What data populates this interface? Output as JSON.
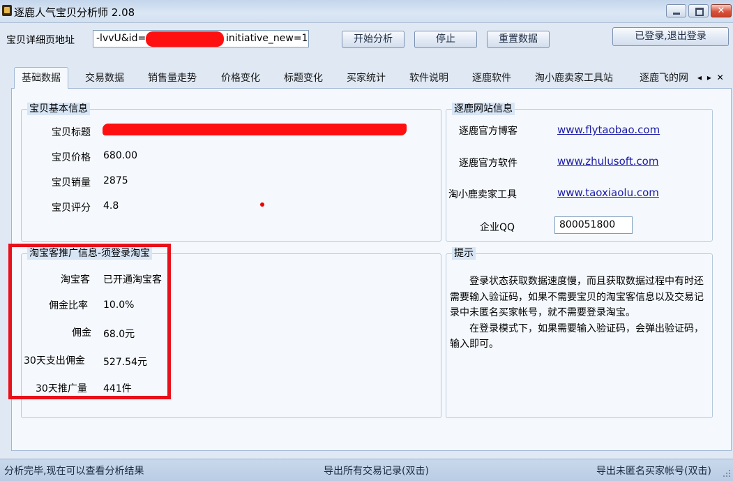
{
  "window": {
    "title": "逐鹿人气宝贝分析师  2.08"
  },
  "url_row": {
    "label": "宝贝详细页地址",
    "value_before": "-lvvU&id=",
    "value_after": "initiative_new=1"
  },
  "buttons": {
    "start": "开始分析",
    "stop": "停止",
    "reset": "重置数据",
    "logout": "已登录,退出登录"
  },
  "tabs": [
    "基础数据",
    "交易数据",
    "销售量走势",
    "价格变化",
    "标题变化",
    "买家统计",
    "软件说明",
    "逐鹿软件",
    "淘小鹿卖家工具站",
    "逐鹿飞的网"
  ],
  "tab_arrows": "◂ ▸ ✕",
  "basic_info": {
    "title": "宝贝基本信息",
    "rows": [
      {
        "label": "宝贝标题",
        "value": ""
      },
      {
        "label": "宝贝价格",
        "value": "680.00"
      },
      {
        "label": "宝贝销量",
        "value": "2875"
      },
      {
        "label": "宝贝评分",
        "value": "4.8"
      }
    ]
  },
  "site_info": {
    "title": "逐鹿网站信息",
    "rows": [
      {
        "label": "逐鹿官方博客",
        "link": "www.flytaobao.com"
      },
      {
        "label": "逐鹿官方软件",
        "link": "www.zhulusoft.com"
      },
      {
        "label": "淘小鹿卖家工具",
        "link": "www.taoxiaolu.com"
      }
    ],
    "qq_label": "企业QQ",
    "qq_value": "800051800"
  },
  "promo_info": {
    "title": "淘宝客推广信息-须登录淘宝",
    "rows": [
      {
        "label": "淘宝客",
        "value": "已开通淘宝客"
      },
      {
        "label": "佣金比率",
        "value": "10.0%"
      },
      {
        "label": "佣金",
        "value": "68.0元"
      },
      {
        "label": "30天支出佣金",
        "value": "527.54元"
      },
      {
        "label": "30天推广量",
        "value": "441件"
      }
    ]
  },
  "tips": {
    "title": "提示",
    "paragraphs": [
      "登录状态获取数据速度慢，而且获取数据过程中有时还需要输入验证码，如果不需要宝贝的淘宝客信息以及交易记录中未匿名买家帐号，就不需要登录淘宝。",
      "在登录模式下，如果需要输入验证码，会弹出验证码，输入即可。"
    ]
  },
  "status": {
    "left": "分析完毕,现在可以查看分析结果",
    "middle": "导出所有交易记录(双击)",
    "right": "导出未匿名买家帐号(双击)"
  },
  "colors": {
    "highlight": "#e8101a",
    "redaction": "#ff1010",
    "link": "#1c1ca8"
  }
}
